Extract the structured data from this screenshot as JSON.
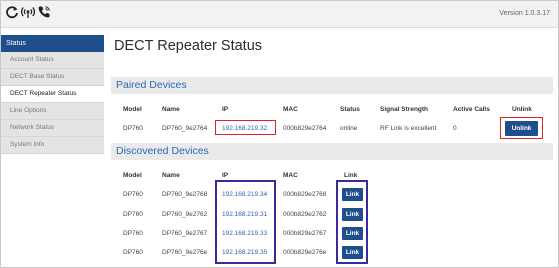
{
  "header": {
    "icons": [
      "refresh-icon",
      "signal-broadcast-icon",
      "phone-icon"
    ],
    "version": "Version 1.0.3.17"
  },
  "sidebar": {
    "heading": "Status",
    "items": [
      {
        "label": "Account Status"
      },
      {
        "label": "DECT Base Status"
      },
      {
        "label": "DECT Repeater Status"
      },
      {
        "label": "Line Options"
      },
      {
        "label": "Network Status"
      },
      {
        "label": "System Info"
      }
    ],
    "active": "DECT Repeater Status"
  },
  "main": {
    "title": "DECT Repeater Status",
    "paired": {
      "heading": "Paired Devices",
      "columns": [
        "Model",
        "Name",
        "IP",
        "MAC",
        "Status",
        "Signal Strength",
        "Active Calls",
        "Unlink"
      ],
      "rows": [
        {
          "model": "DP760",
          "name": "DP760_9e2764",
          "ip": "192.168.219.32",
          "mac": "000b829e2764",
          "status": "online",
          "signal": "RF Link is excellent",
          "calls": "0",
          "action": "Unlink"
        }
      ]
    },
    "discovered": {
      "heading": "Discovered Devices",
      "columns": [
        "Model",
        "Name",
        "IP",
        "MAC",
        "Link"
      ],
      "rows": [
        {
          "model": "DP760",
          "name": "DP760_9e2768",
          "ip": "192.168.219.34",
          "mac": "000b829e2768",
          "action": "Link"
        },
        {
          "model": "DP760",
          "name": "DP760_9e2762",
          "ip": "192.168.219.31",
          "mac": "000b829e2762",
          "action": "Link"
        },
        {
          "model": "DP760",
          "name": "DP760_9e2767",
          "ip": "192.168.219.33",
          "mac": "000b829e2767",
          "action": "Link"
        },
        {
          "model": "DP760",
          "name": "DP760_9e276e",
          "ip": "192.168.219.35",
          "mac": "000b829e276e",
          "action": "Link"
        }
      ]
    }
  },
  "colors": {
    "accent": "#1f4e8e",
    "link_text": "#2c66b0",
    "section_text": "#2a6ab3",
    "highlight_red": "#e0202a",
    "highlight_blue": "#3a2a9a"
  }
}
